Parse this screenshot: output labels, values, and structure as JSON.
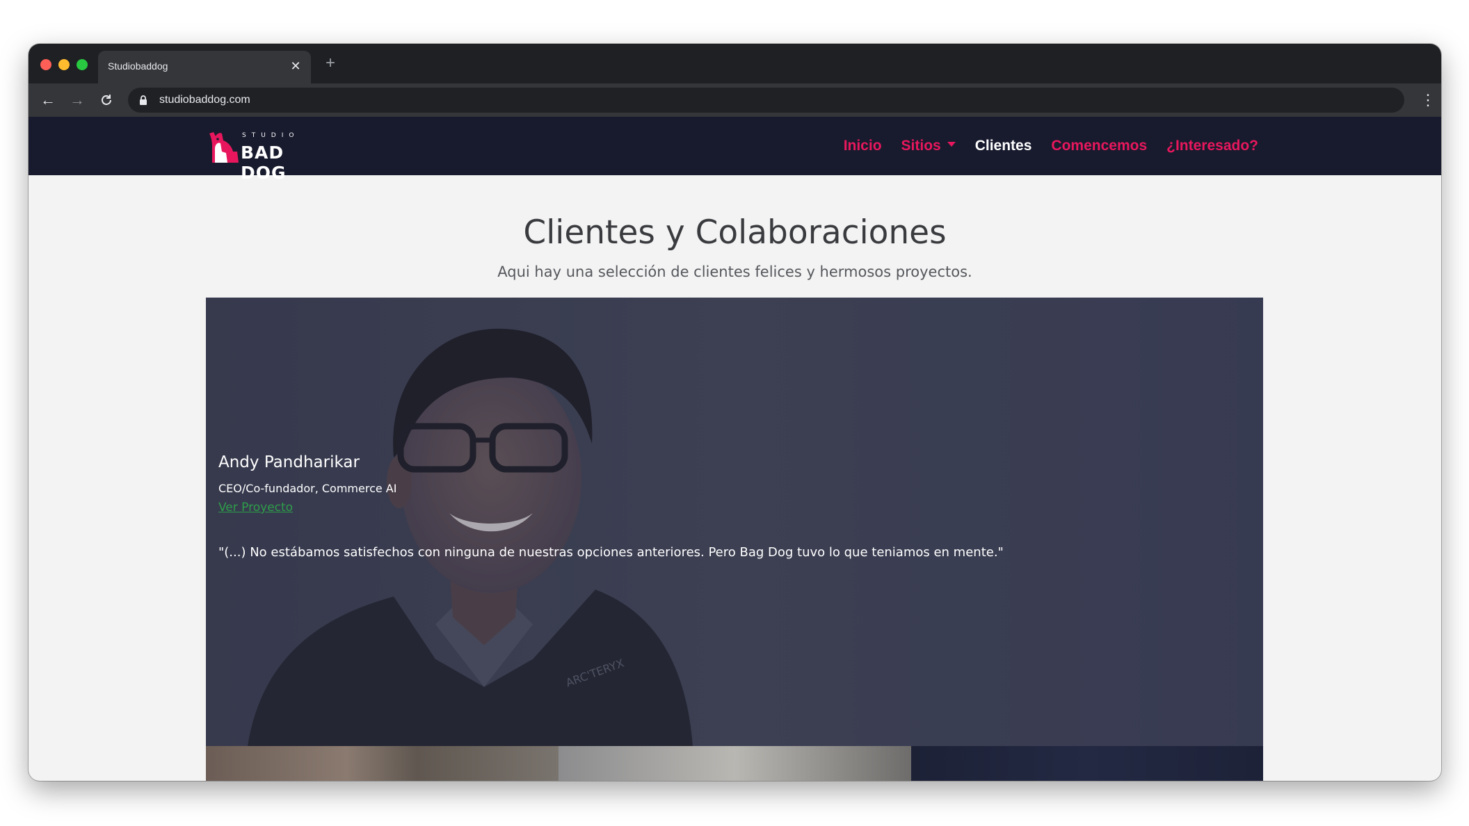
{
  "browser": {
    "tab_title": "Studiobaddog",
    "url": "studiobaddog.com"
  },
  "site": {
    "logo_top": "STUDIO",
    "logo_main": "BAD DOG",
    "nav": {
      "inicio": "Inicio",
      "sitios": "Sitios",
      "clientes": "Clientes",
      "comencemos": "Comencemos",
      "interesado": "¿Interesado?"
    },
    "accent_color": "#e8175d",
    "nav_background": "#181b2e"
  },
  "page": {
    "title": "Clientes y Colaboraciones",
    "subtitle": "Aqui hay una selección de clientes felices y hermosos proyectos."
  },
  "testimonial": {
    "name": "Andy Pandharikar",
    "role": "CEO/Co-fundador, Commerce AI",
    "link_label": "Ver Proyecto",
    "quote": "\"(...) No estábamos satisfechos con ninguna de nuestras opciones anteriores. Pero Bag Dog tuvo lo que teniamos en mente.\"",
    "jacket_brand": "ARC'TERYX"
  }
}
